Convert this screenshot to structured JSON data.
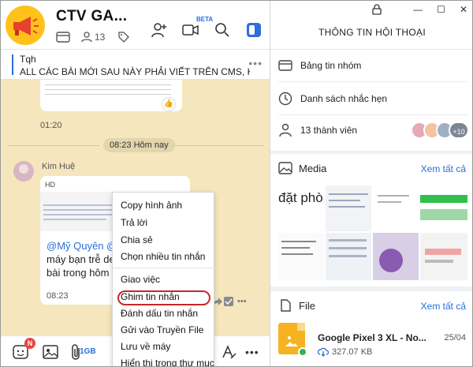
{
  "chat": {
    "title": "CTV GA...",
    "member_count": "13",
    "beta": "BETA",
    "pinned": {
      "sender": "Tqh",
      "message": "ALL CÁC BÀI MỚI SAU NÀY PHẢI VIẾT TRÊN CMS, KO ..."
    },
    "time_prev": "01:20",
    "date_divider": "08:23 Hôm nay",
    "sender_name": "Kim Huệ",
    "message": {
      "thumb_label": "HD",
      "mention": "@Mỹ Quyên @D",
      "text_line2": "máy bạn trễ de",
      "text_line3": "bài trong hôm n",
      "time": "08:23"
    },
    "composer": {
      "badge": "N",
      "size_label": "1GB"
    }
  },
  "context_menu": {
    "items": [
      "Copy hình ảnh",
      "Trả lời",
      "Chia sẻ",
      "Chọn nhiều tin nhắn",
      "Giao việc",
      "Ghim tin nhắn",
      "Đánh dấu tin nhắn",
      "Gửi vào Truyền File",
      "Lưu về máy",
      "Hiển thị trong thư mục"
    ],
    "highlighted": "Ghim tin nhắn"
  },
  "info": {
    "title": "THÔNG TIN HỘI THOẠI",
    "rows": [
      "Bảng tin nhóm",
      "Danh sách nhắc hẹn",
      "13 thành viên"
    ],
    "more_members": "+10",
    "media_label": "Media",
    "see_all": "Xem tất cả",
    "media_tile_text": "đặt phòng",
    "file_label": "File",
    "file_see_all": "Xem tất cả",
    "file": {
      "name": "Google Pixel 3 XL - No...",
      "size": "327.07 KB",
      "date": "25/04"
    }
  },
  "colors": {
    "accent": "#2a6fdb",
    "chat_bg": "#f6e6bd",
    "highlight": "#c7262a"
  }
}
